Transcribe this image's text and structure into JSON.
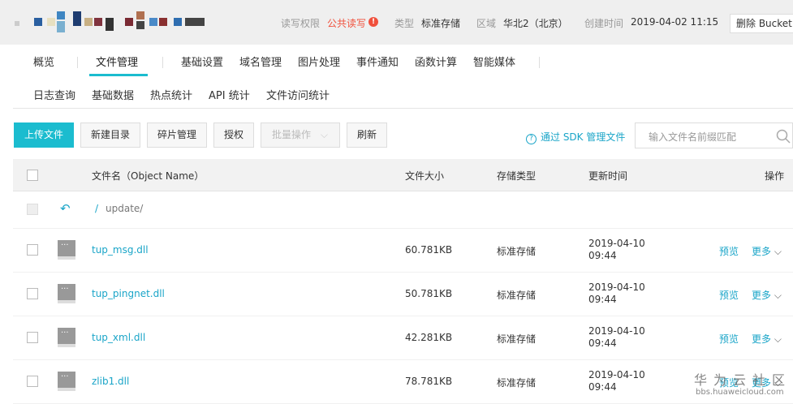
{
  "header": {
    "permission_label": "读写权限",
    "permission_value": "公共读写",
    "type_label": "类型",
    "type_value": "标准存储",
    "region_label": "区域",
    "region_value": "华北2（北京）",
    "created_label": "创建时间",
    "created_value": "2019-04-02 11:15",
    "delete_button": "删除 Bucket",
    "accent_warning": "#f0503c"
  },
  "tabs": [
    "概览",
    "文件管理",
    "基础设置",
    "域名管理",
    "图片处理",
    "事件通知",
    "函数计算",
    "智能媒体"
  ],
  "subtabs": [
    "日志查询",
    "基础数据",
    "热点统计",
    "API 统计",
    "文件访问统计"
  ],
  "toolbar": {
    "upload": "上传文件",
    "new_dir": "新建目录",
    "fragments": "碎片管理",
    "authorize": "授权",
    "batch": "批量操作",
    "refresh": "刷新",
    "sdk_link": "通过 SDK 管理文件",
    "search_placeholder": "输入文件名前缀匹配"
  },
  "table": {
    "headers": {
      "name": "文件名（Object Name）",
      "size": "文件大小",
      "type": "存储类型",
      "time": "更新时间",
      "actions": "操作"
    },
    "path": "update/",
    "rows": [
      {
        "name": "tup_msg.dll",
        "size": "60.781KB",
        "type": "标准存储",
        "date": "2019-04-10",
        "time": "09:44"
      },
      {
        "name": "tup_pingnet.dll",
        "size": "50.781KB",
        "type": "标准存储",
        "date": "2019-04-10",
        "time": "09:44"
      },
      {
        "name": "tup_xml.dll",
        "size": "42.281KB",
        "type": "标准存储",
        "date": "2019-04-10",
        "time": "09:44"
      },
      {
        "name": "zlib1.dll",
        "size": "78.781KB",
        "type": "标准存储",
        "date": "2019-04-10",
        "time": "09:44"
      }
    ],
    "preview": "预览",
    "more": "更多"
  },
  "watermark": {
    "title": "华为云社区",
    "url": "bbs.huaweicloud.com"
  }
}
